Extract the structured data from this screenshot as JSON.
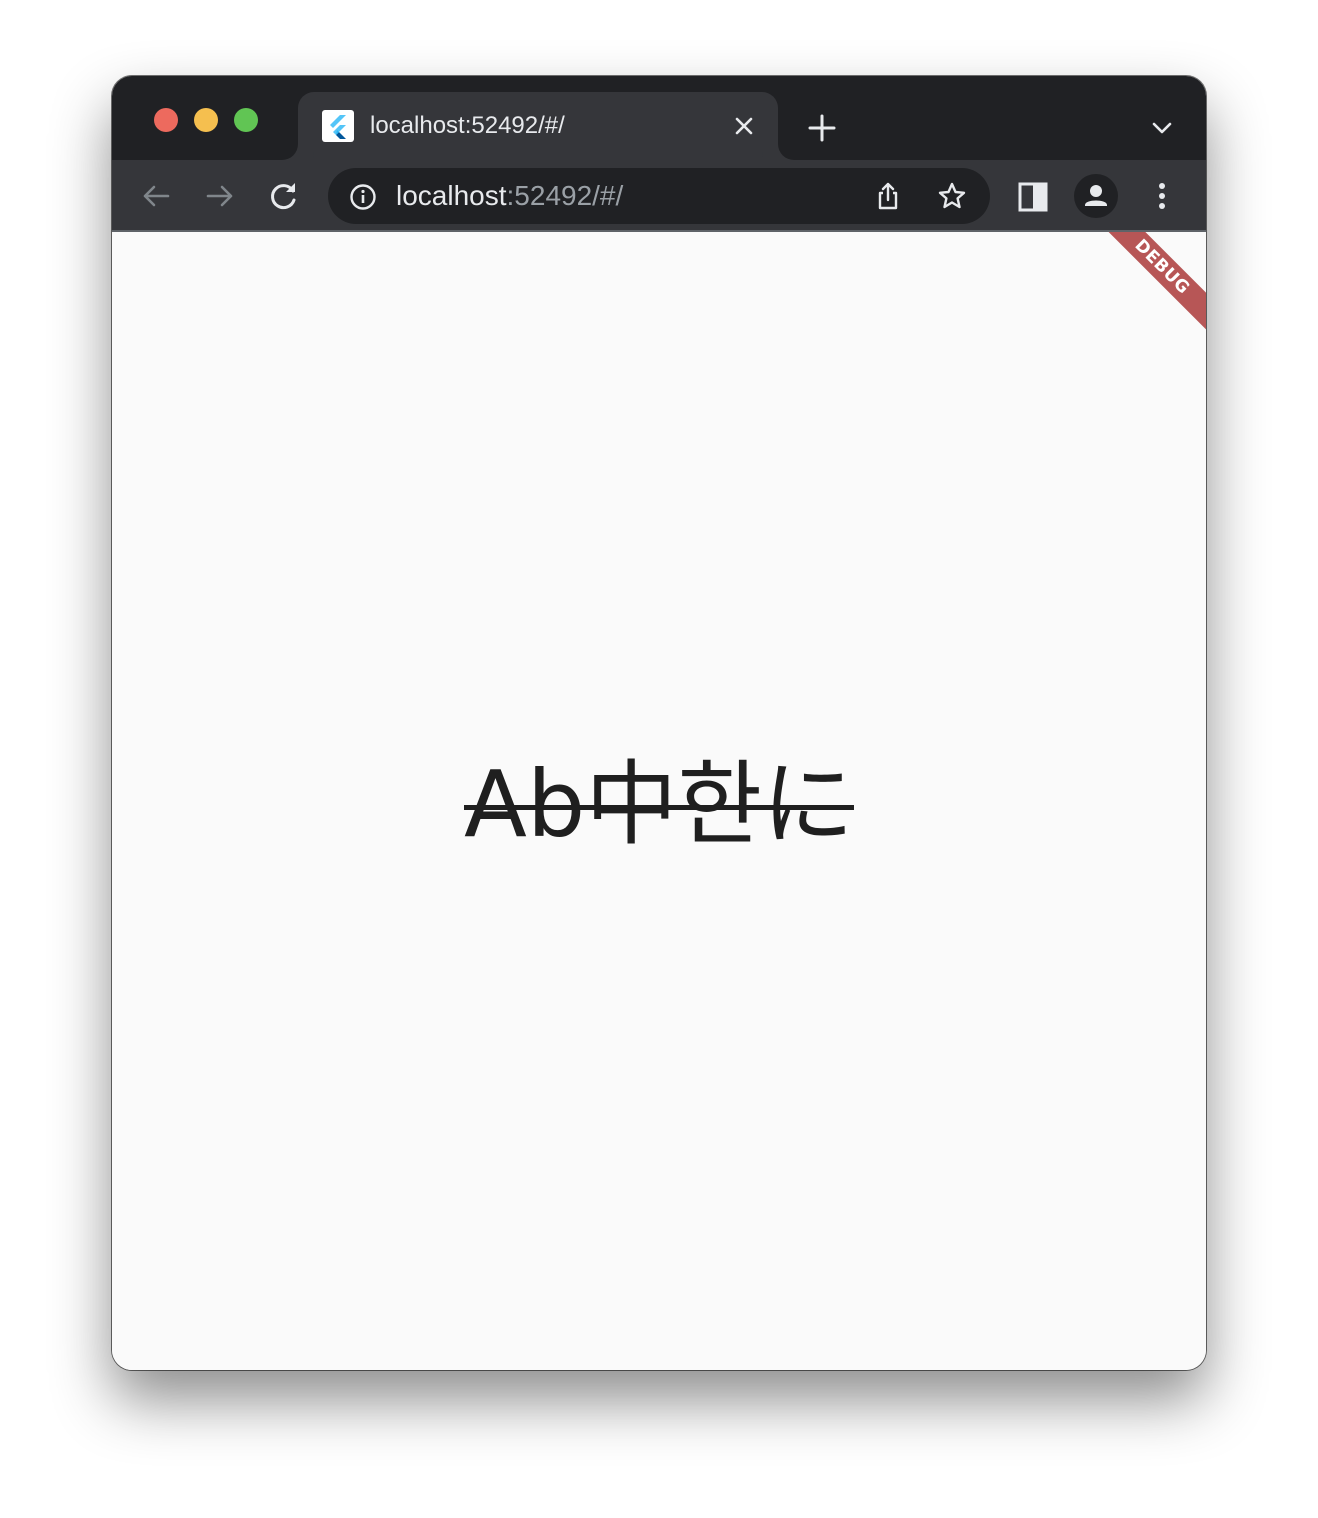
{
  "tab": {
    "title": "localhost:52492/#/"
  },
  "omnibox": {
    "url_host": "localhost",
    "url_rest": ":52492/#/"
  },
  "page": {
    "debug_banner": "DEBUG",
    "sample_text": "Ab中한に"
  },
  "colors": {
    "titlebar": "#202124",
    "toolbar": "#35363a",
    "page_background": "#fafafa",
    "text": "#1f1f1f",
    "debug_banner": "#a62d2d"
  },
  "icons": {
    "favicon": "flutter-logo",
    "tab_close": "close-icon",
    "new_tab": "plus-icon",
    "tab_search": "chevron-down-icon",
    "back": "arrow-left-icon",
    "forward": "arrow-right-icon",
    "reload": "reload-icon",
    "site_info": "info-icon",
    "share": "share-icon",
    "bookmark": "star-icon",
    "side_panel": "side-panel-icon",
    "profile": "person-icon",
    "menu": "kebab-menu-icon"
  }
}
